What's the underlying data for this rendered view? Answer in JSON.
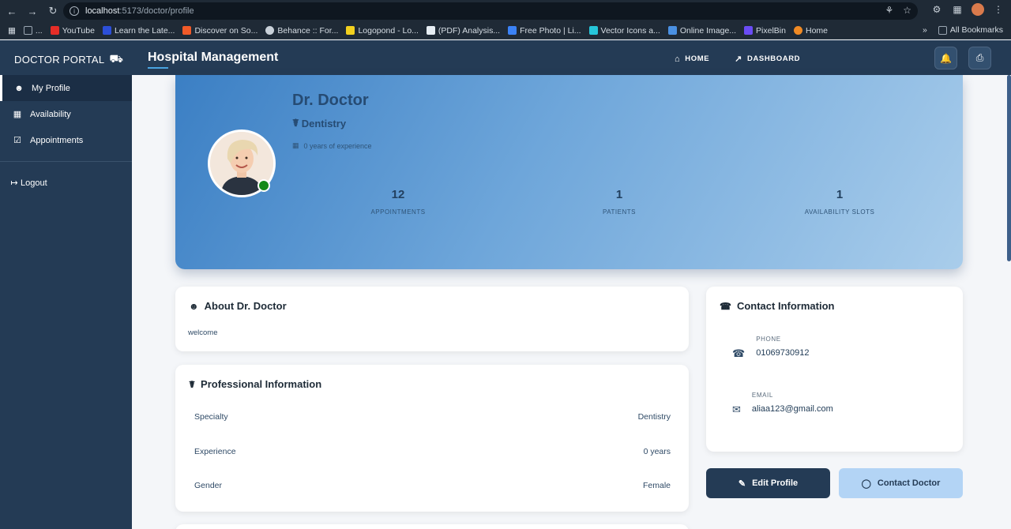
{
  "browser": {
    "url_host": "localhost",
    "url_path": ":5173/doctor/profile",
    "bookmarks": [
      {
        "label": "...",
        "color": "#9aa6b2"
      },
      {
        "label": "YouTube",
        "color": "#e52d27"
      },
      {
        "label": "Learn the Late...",
        "color": "#2c4fd8"
      },
      {
        "label": "Discover on So...",
        "color": "#f05a28"
      },
      {
        "label": "Behance :: For...",
        "color": "#c9d1d9"
      },
      {
        "label": "Logopond - Lo...",
        "color": "#f2d01e"
      },
      {
        "label": "(PDF) Analysis...",
        "color": "#e6edf3"
      },
      {
        "label": "Free Photo | Li...",
        "color": "#3b82f6"
      },
      {
        "label": "Vector Icons a...",
        "color": "#26c6da"
      },
      {
        "label": "Online Image...",
        "color": "#4a90e2"
      },
      {
        "label": "PixelBin",
        "color": "#6a4cf5"
      },
      {
        "label": "Home",
        "color": "#f08a24"
      }
    ],
    "all_bookmarks": "All Bookmarks"
  },
  "header": {
    "brand": "DOCTOR PORTAL",
    "title": "Hospital Management",
    "nav": [
      {
        "label": "HOME",
        "icon": "home-icon"
      },
      {
        "label": "DASHBOARD",
        "icon": "chart-icon"
      }
    ]
  },
  "sidebar": {
    "items": [
      {
        "label": "My Profile",
        "icon": "user-icon"
      },
      {
        "label": "Availability",
        "icon": "calendar-icon"
      },
      {
        "label": "Appointments",
        "icon": "calendar-check-icon"
      }
    ],
    "logout": "Logout"
  },
  "profile": {
    "name": "Dr. Doctor",
    "specialty": "Dentistry",
    "experience_text": "0 years of experience",
    "stats": [
      {
        "value": "12",
        "label": "APPOINTMENTS"
      },
      {
        "value": "1",
        "label": "PATIENTS"
      },
      {
        "value": "1",
        "label": "AVAILABILITY SLOTS"
      }
    ]
  },
  "about": {
    "title": "About Dr. Doctor",
    "text": "welcome"
  },
  "professional": {
    "title": "Professional Information",
    "rows": [
      {
        "label": "Specialty",
        "value": "Dentistry"
      },
      {
        "label": "Experience",
        "value": "0 years"
      },
      {
        "label": "Gender",
        "value": "Female"
      }
    ]
  },
  "contact": {
    "title": "Contact Information",
    "phone_label": "PHONE",
    "phone": "01069730912",
    "email_label": "EMAIL",
    "email": "aliaa123@gmail.com"
  },
  "actions": {
    "edit": "Edit Profile",
    "contact": "Contact Doctor"
  },
  "colors": {
    "navy": "#243b55",
    "accent": "#4aa3df",
    "online": "#138a1a"
  }
}
